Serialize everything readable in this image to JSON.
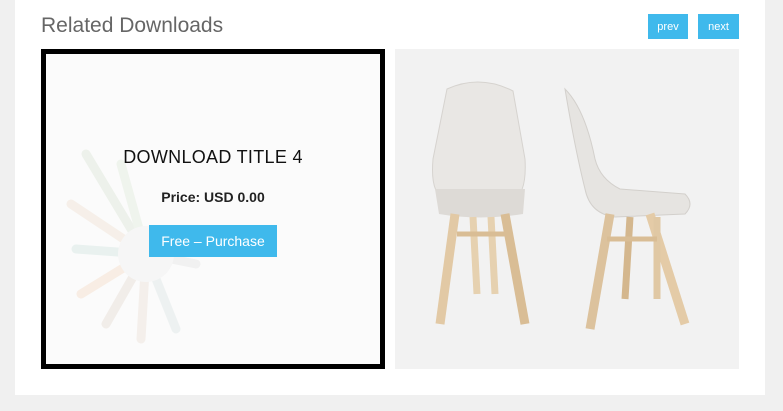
{
  "section": {
    "title": "Related Downloads"
  },
  "nav": {
    "prev_label": "prev",
    "next_label": "next"
  },
  "items": [
    {
      "title": "DOWNLOAD TITLE 4",
      "price": "Price: USD 0.00",
      "button_label": "Free – Purchase"
    },
    {
      "image": "white-chairs-photo"
    }
  ],
  "colors": {
    "accent": "#3fb9ec",
    "heading": "#666666",
    "page_bg": "#f0f0f0"
  }
}
